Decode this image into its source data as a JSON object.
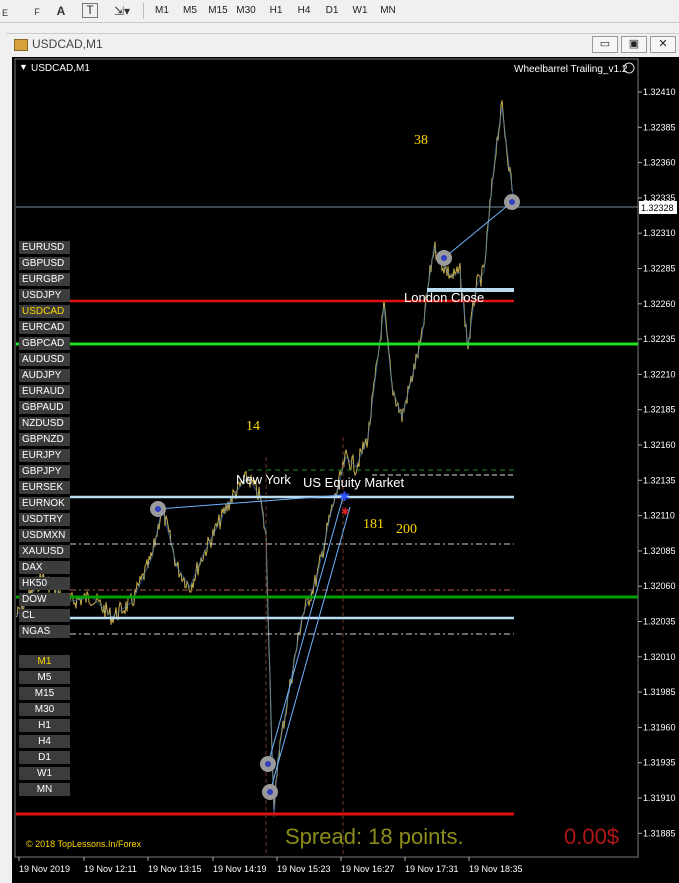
{
  "toolbar": {
    "icons": [
      "cursor-e-icon",
      "f-icon",
      "text-a-icon",
      "text-t-icon",
      "arrows-icon"
    ],
    "e_label": "E",
    "f_label": "F",
    "a_label": "A",
    "t_label": "T",
    "timeframes": [
      "M1",
      "M5",
      "M15",
      "M30",
      "H1",
      "H4",
      "D1",
      "W1",
      "MN"
    ]
  },
  "window": {
    "title": "USDCAD,M1",
    "minimize": "▭",
    "restore": "▣",
    "close": "✕"
  },
  "chart": {
    "symbol_label": "USDCAD,M1",
    "indicator_label": "Wheelbarrel Trailing_v1.2",
    "current_price": "1.32328",
    "price_labels": [
      "1.32410",
      "1.32385",
      "1.32360",
      "1.32335",
      "1.32310",
      "1.32285",
      "1.32260",
      "1.32235",
      "1.32210",
      "1.32185",
      "1.32160",
      "1.32135",
      "1.32110",
      "1.32085",
      "1.32060",
      "1.32035",
      "1.32010",
      "1.31985",
      "1.31960",
      "1.31935",
      "1.31910",
      "1.31885"
    ],
    "time_labels": [
      "19 Nov 2019",
      "19 Nov 12:11",
      "19 Nov 13:15",
      "19 Nov 14:19",
      "19 Nov 15:23",
      "19 Nov 16:27",
      "19 Nov 17:31",
      "19 Nov 18:35"
    ],
    "annotations": {
      "n38": "38",
      "n14": "14",
      "n181": "181",
      "n200": "200",
      "new_york": "New York",
      "us_equity": "US Equity Market",
      "london_close": "London Close"
    },
    "copyright": "© 2018 TopLessons.In/Forex",
    "spread": "Spread: 18 points.",
    "profit": "0.00$"
  },
  "symbols": [
    "EURUSD",
    "GBPUSD",
    "EURGBP",
    "USDJPY",
    "USDCAD",
    "EURCAD",
    "GBPCAD",
    "AUDUSD",
    "AUDJPY",
    "EURAUD",
    "GBPAUD",
    "NZDUSD",
    "GBPNZD",
    "EURJPY",
    "GBPJPY",
    "EURSEK",
    "EURNOK",
    "USDTRY",
    "USDMXN",
    "XAUUSD",
    "DAX",
    "HK50",
    "DOW",
    "CL",
    "NGAS"
  ],
  "timeframe_buttons": [
    "M1",
    "M5",
    "M15",
    "M30",
    "H1",
    "H4",
    "D1",
    "W1",
    "MN"
  ],
  "colors": {
    "active": "#ffd700",
    "red_line": "#e01010",
    "green_line": "#22e022",
    "dark_green_line": "#00a000",
    "light_blue_line": "#b9dcf0",
    "price_series": "#c8b04a",
    "trail_line": "#6fb4ff",
    "spread_text": "#8c8c1a",
    "profit_text": "#b01818"
  }
}
